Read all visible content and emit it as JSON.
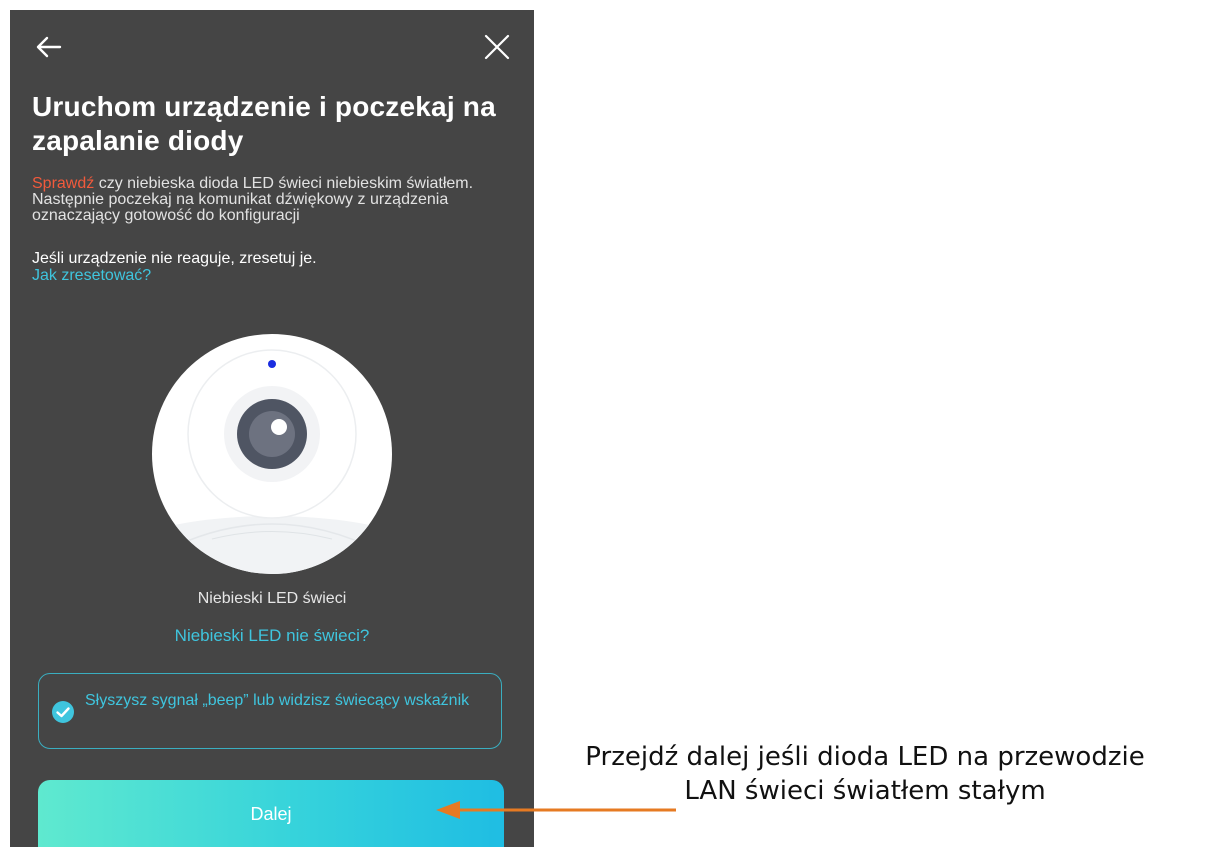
{
  "header": {
    "back_icon": "arrow-left-icon",
    "close_icon": "close-x-icon"
  },
  "title": "Uruchom urządzenie i poczekaj na zapalanie diody",
  "description": {
    "highlight": "Sprawdź",
    "text": " czy niebieska dioda LED świeci niebieskim światłem. Następnie poczekaj na komunikat dźwiękowy z urządzenia oznaczający gotowość do konfiguracji"
  },
  "warning": "Jeśli urządzenie nie reaguje, zresetuj je.",
  "reset_link": "Jak zresetować?",
  "led": {
    "caption": "Niebieski LED świeci",
    "not_lit_link": "Niebieski LED nie świeci?",
    "led_color": "#1a2de0"
  },
  "confirm": {
    "checked": true,
    "icon": "check-circle-icon",
    "text": "Słyszysz sygnał „beep” lub widzisz świecący wskaźnik"
  },
  "next_button": "Dalej",
  "annotation": {
    "line1": "Przejdź dalej jeśli dioda LED na przewodzie",
    "line2": "LAN świeci światłem stałym",
    "arrow_color": "#e67a22"
  },
  "colors": {
    "background": "#454545",
    "accent": "#3fc5de",
    "highlight": "#f25a3c"
  }
}
